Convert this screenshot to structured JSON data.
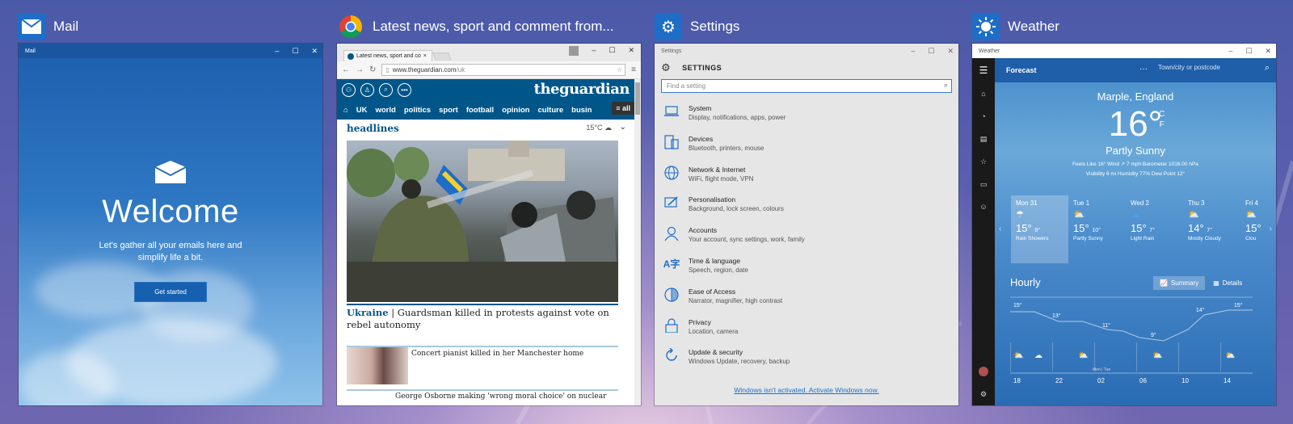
{
  "mail": {
    "task_title": "Mail",
    "window_title": "Mail",
    "welcome": "Welcome",
    "subtitle": "Let's gather all your emails here and simplify life a bit.",
    "button": "Get started"
  },
  "chrome": {
    "task_title": "Latest news, sport and comment from...",
    "tab_title": "Latest news, sport and co",
    "url_host": "www.theguardian.com",
    "url_path": "/uk",
    "logo": "theguardian",
    "nav": [
      "UK",
      "world",
      "politics",
      "sport",
      "football",
      "opinion",
      "culture",
      "busin"
    ],
    "all_label": "all",
    "headlines": "headlines",
    "temp": "15°C",
    "story_kicker": "Ukraine",
    "story_title": "Guardsman killed in protests against vote on rebel autonomy",
    "card1": "Concert pianist killed in her Manchester home",
    "card2": "George Osborne making 'wrong moral choice' on nuclear"
  },
  "settings": {
    "task_title": "Settings",
    "window_title": "Settings",
    "header": "SETTINGS",
    "search_placeholder": "Find a setting",
    "items": [
      {
        "name": "System",
        "desc": "Display, notifications, apps, power",
        "icon": "laptop-icon"
      },
      {
        "name": "Devices",
        "desc": "Bluetooth, printers, mouse",
        "icon": "devices-icon"
      },
      {
        "name": "Network & Internet",
        "desc": "WiFi, flight mode, VPN",
        "icon": "globe-icon"
      },
      {
        "name": "Personalisation",
        "desc": "Background, lock screen, colours",
        "icon": "paint-icon"
      },
      {
        "name": "Accounts",
        "desc": "Your account, sync settings, work, family",
        "icon": "person-icon"
      },
      {
        "name": "Time & language",
        "desc": "Speech, region, date",
        "icon": "language-icon"
      },
      {
        "name": "Ease of Access",
        "desc": "Narrator, magnifier, high contrast",
        "icon": "ease-icon"
      },
      {
        "name": "Privacy",
        "desc": "Location, camera",
        "icon": "lock-icon"
      },
      {
        "name": "Update & security",
        "desc": "Windows Update, recovery, backup",
        "icon": "refresh-icon"
      }
    ],
    "activate": "Windows isn't activated. Activate Windows now."
  },
  "weather": {
    "task_title": "Weather",
    "window_title": "Weather",
    "forecast": "Forecast",
    "search_placeholder": "Town/city or postcode",
    "location": "Marple, England",
    "temp": "16°",
    "unit_c": "C",
    "unit_f": "F",
    "condition": "Partly Sunny",
    "details_line1": "Feels Like  16°    Wind  ↗ 7 mph    Barometer  1016.00 hPa",
    "details_line2": "Visibility  6 mi    Humidity  77%    Dew Point  12°",
    "days": [
      {
        "day": "Mon 31",
        "hi": "15°",
        "lo": "9°",
        "cond": "Rain Showers"
      },
      {
        "day": "Tue 1",
        "hi": "15°",
        "lo": "10°",
        "cond": "Partly Sunny"
      },
      {
        "day": "Wed 2",
        "hi": "15°",
        "lo": "7°",
        "cond": "Light Rain"
      },
      {
        "day": "Thu 3",
        "hi": "14°",
        "lo": "7°",
        "cond": "Mostly Cloudy"
      },
      {
        "day": "Fri 4",
        "hi": "15°",
        "lo": "",
        "cond": "Clou"
      }
    ],
    "hourly": "Hourly",
    "summary_tab": "Summary",
    "details_tab": "Details",
    "hour_ticks": [
      "18",
      "22",
      "02",
      "06",
      "10",
      "14"
    ],
    "mon_tue": "Mon | Tue",
    "hour_temps": [
      "15°",
      "13°",
      "11°",
      "9°",
      "14°",
      "15°"
    ]
  }
}
